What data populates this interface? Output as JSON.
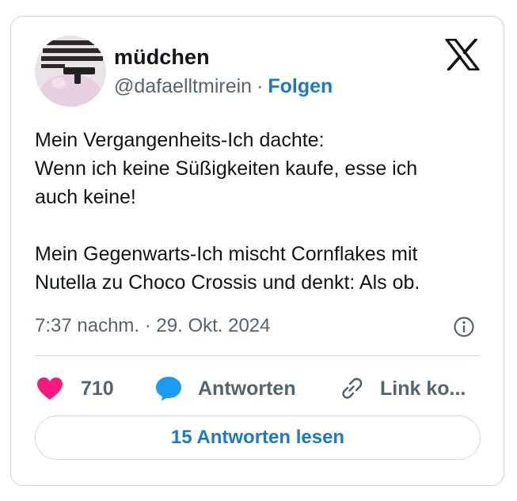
{
  "author": {
    "display_name": "müdchen",
    "handle": "@dafaelltmirein",
    "separator": "·",
    "follow_label": "Folgen"
  },
  "tweet": {
    "paragraphs": [
      [
        "Mein Vergangenheits-Ich dachte:",
        "Wenn ich keine Süßigkeiten kaufe, esse ich",
        "auch keine!"
      ],
      [
        "Mein Gegenwarts-Ich mischt Cornflakes mit",
        "Nutella zu Choco Crossis und denkt: Als ob."
      ]
    ],
    "timestamp": "7:37 nachm. · 29. Okt. 2024"
  },
  "actions": {
    "like_count": "710",
    "reply_label": "Antworten",
    "copy_link_label": "Link ko..."
  },
  "read_replies_label": "15 Antworten lesen",
  "icons": {
    "logo": "x-logo",
    "like": "heart-icon",
    "reply": "speech-bubble-icon",
    "copy": "link-icon",
    "info": "info-icon"
  },
  "colors": {
    "link_blue": "#1d79c2",
    "heart_pink": "#f91880",
    "reply_blue": "#1d9bf0",
    "muted_text": "#536471",
    "border": "#cfd9de"
  }
}
